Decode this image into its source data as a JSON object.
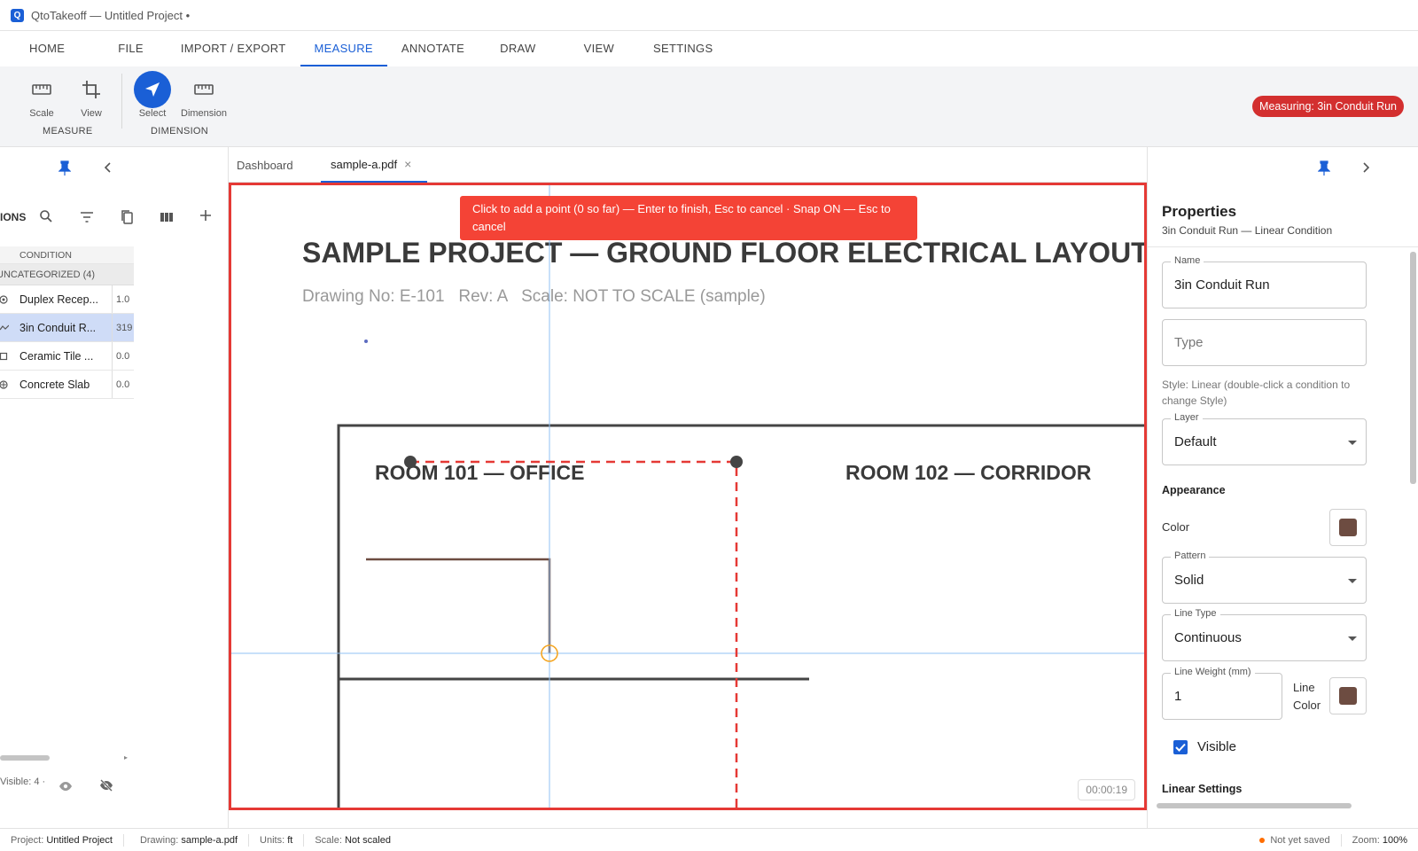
{
  "window": {
    "title": "QtoTakeoff — Untitled Project •",
    "logo_letter": "Q"
  },
  "menu": {
    "tabs": [
      "HOME",
      "FILE",
      "IMPORT / EXPORT",
      "MEASURE",
      "ANNOTATE",
      "DRAW",
      "VIEW",
      "SETTINGS"
    ],
    "active": "MEASURE"
  },
  "ribbon": {
    "tools": {
      "scale": "Scale",
      "view": "View",
      "select": "Select",
      "dimension": "Dimension"
    },
    "groups": {
      "measure": "MEASURE",
      "dimension": "DIMENSION"
    },
    "status_badge": "Measuring: 3in Conduit Run",
    "accent_color": "#1a5fd6",
    "badge_color": "#d32f2f"
  },
  "left_panel": {
    "section_title_partial": "IONS",
    "table_header": "CONDITION",
    "group": "UNCATEGORIZED (4)",
    "rows": [
      {
        "name": "Duplex Recep...",
        "value": "1.0",
        "icon": "point-icon"
      },
      {
        "name": "3in Conduit R...",
        "value": "319",
        "icon": "linear-icon",
        "selected": true
      },
      {
        "name": "Ceramic Tile ...",
        "value": "0.0",
        "icon": "area-icon"
      },
      {
        "name": "Concrete Slab",
        "value": "0.0",
        "icon": "volume-icon"
      }
    ],
    "footer_text": "Visible: 4 ·"
  },
  "doc_tabs": {
    "dashboard": "Dashboard",
    "active_file": "sample-a.pdf",
    "close_glyph": "×"
  },
  "canvas": {
    "hint": "Click to add a point (0 so far) — Enter to finish, Esc to cancel · Snap ON — Esc to cancel",
    "drawing_title": "SAMPLE PROJECT — GROUND FLOOR ELECTRICAL LAYOUT",
    "drawing_meta": "Drawing No: E-101   Rev: A   Scale: NOT TO SCALE (sample)",
    "room_101": "ROOM 101 — OFFICE",
    "room_102": "ROOM 102 — CORRIDOR",
    "timer": "00:00:19",
    "measure_color": "#e53935",
    "conduit_color": "#6d4c41"
  },
  "properties": {
    "title": "Properties",
    "subtitle": "3in Conduit Run — Linear Condition",
    "name_label": "Name",
    "name_value": "3in Conduit Run",
    "type_placeholder": "Type",
    "style_note": "Style: Linear (double-click a condition to change Style)",
    "layer_label": "Layer",
    "layer_value": "Default",
    "appearance": "Appearance",
    "color_label": "Color",
    "color_value": "#6d4c41",
    "pattern_label": "Pattern",
    "pattern_value": "Solid",
    "linetype_label": "Line Type",
    "linetype_value": "Continuous",
    "lineweight_label": "Line Weight (mm)",
    "lineweight_value": "1",
    "linecolor_label": "Line Color",
    "visible_label": "Visible",
    "visible_checked": true,
    "linear_settings": "Linear Settings"
  },
  "statusbar": {
    "project_label": "Project:",
    "project": "Untitled Project",
    "drawing_label": "Drawing:",
    "drawing": "sample-a.pdf",
    "units_label": "Units:",
    "units": "ft",
    "scale_label": "Scale:",
    "scale": "Not scaled",
    "save_state": "Not yet saved",
    "zoom_label": "Zoom:",
    "zoom": "100%"
  }
}
